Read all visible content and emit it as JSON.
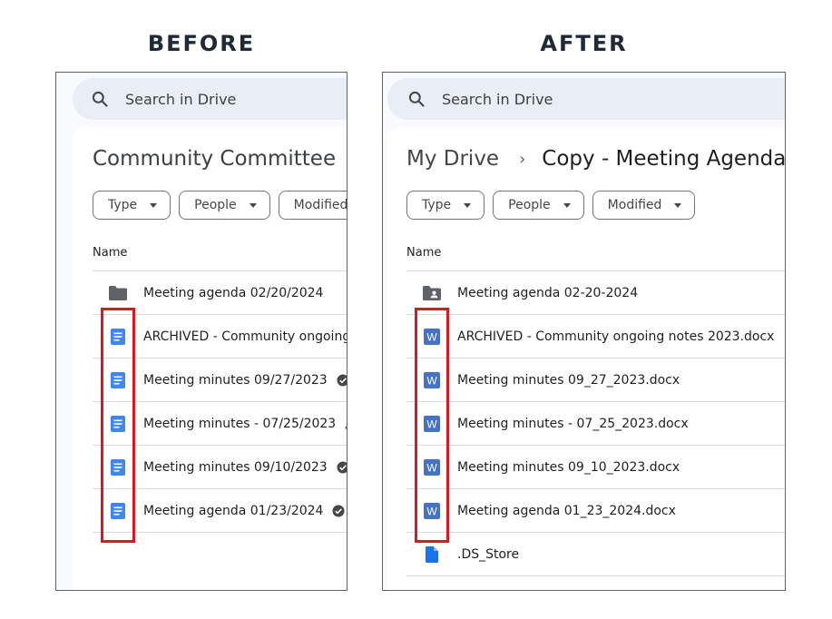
{
  "headings": {
    "before": "BEFORE",
    "after": "AFTER"
  },
  "colors": {
    "highlight": "#e0161e",
    "doc_blue": "#4285f4",
    "word_blue": "#4472c4",
    "folder_gray": "#5f6368"
  },
  "before": {
    "search_text": "Search in Drive",
    "title": "Community Committee",
    "title_close": "×",
    "filters": [
      "Type",
      "People",
      "Modified"
    ],
    "column_header": "Name",
    "rows": [
      {
        "name": "Meeting agenda 02/20/2024",
        "icon": "folder-icon"
      },
      {
        "name": "ARCHIVED - Community ongoing n",
        "icon": "google-doc-icon"
      },
      {
        "name": "Meeting minutes 09/27/2023",
        "icon": "google-doc-icon",
        "badges": [
          "approved-icon",
          "shared-icon"
        ]
      },
      {
        "name": "Meeting minutes - 07/25/2023",
        "icon": "google-doc-icon",
        "badges": [
          "shared-icon"
        ]
      },
      {
        "name": "Meeting minutes 09/10/2023",
        "icon": "google-doc-icon",
        "badges": [
          "approved-icon"
        ]
      },
      {
        "name": "Meeting agenda 01/23/2024",
        "icon": "google-doc-icon",
        "badges": [
          "approved-icon",
          "shared-icon"
        ]
      }
    ]
  },
  "after": {
    "search_text": "Search in Drive",
    "breadcrumb_root": "My Drive",
    "breadcrumb_separator": "›",
    "breadcrumb_current": "Copy - Meeting Agenda...",
    "filters": [
      "Type",
      "People",
      "Modified"
    ],
    "column_header": "Name",
    "rows": [
      {
        "name": "Meeting agenda 02-20-2024",
        "icon": "shared-folder-icon"
      },
      {
        "name": "ARCHIVED - Community ongoing notes 2023.docx",
        "icon": "word-doc-icon",
        "word_letter": "W"
      },
      {
        "name": "Meeting minutes 09_27_2023.docx",
        "icon": "word-doc-icon",
        "word_letter": "W"
      },
      {
        "name": "Meeting minutes - 07_25_2023.docx",
        "icon": "word-doc-icon",
        "word_letter": "W"
      },
      {
        "name": "Meeting minutes 09_10_2023.docx",
        "icon": "word-doc-icon",
        "word_letter": "W"
      },
      {
        "name": "Meeting agenda 01_23_2024.docx",
        "icon": "word-doc-icon",
        "word_letter": "W"
      },
      {
        "name": ".DS_Store",
        "icon": "file-icon"
      }
    ]
  }
}
